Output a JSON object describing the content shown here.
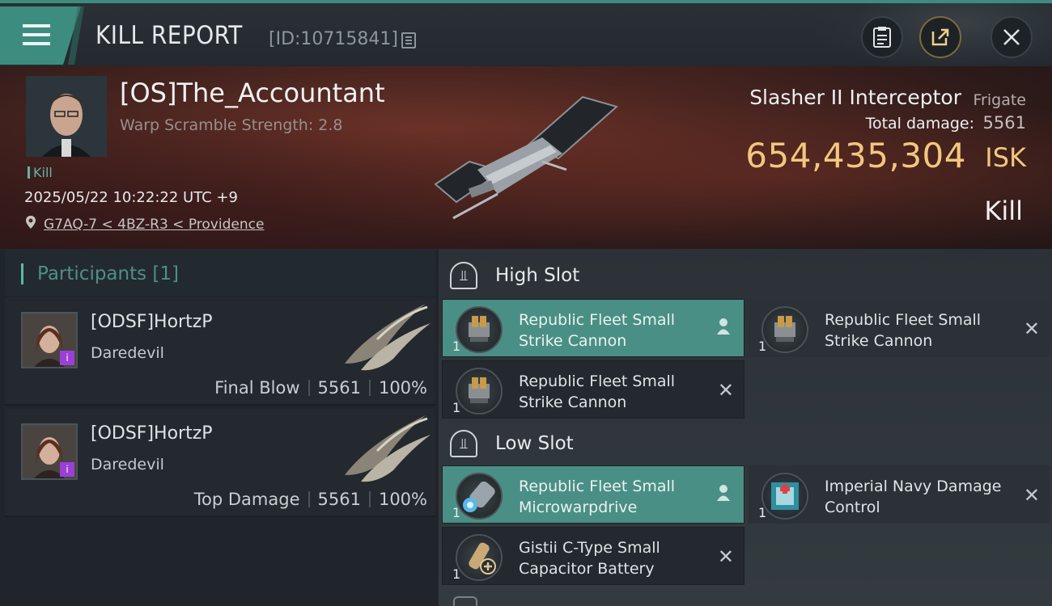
{
  "header": {
    "title": "KILL REPORT",
    "report_id": "[ID:10715841]"
  },
  "victim": {
    "name": "[OS]The_Accountant",
    "scramble": "Warp Scramble Strength: 2.8",
    "tag": "Kill",
    "datetime": "2025/05/22 10:22:22 UTC +9",
    "location": "G7AQ-7 < 4BZ-R3 < Providence",
    "ship_name": "Slasher II Interceptor",
    "ship_class": "Frigate",
    "total_damage_label": "Total damage:",
    "total_damage": "5561",
    "isk_value": "654,435,304",
    "isk_unit": "ISK",
    "kill_type": "Kill"
  },
  "participants": {
    "title": "Participants [1]",
    "items": [
      {
        "name": "[ODSF]HortzP",
        "ship": "Daredevil",
        "role": "Final Blow",
        "damage": "5561",
        "percent": "100%"
      },
      {
        "name": "[ODSF]HortzP",
        "ship": "Daredevil",
        "role": "Top Damage",
        "damage": "5561",
        "percent": "100%"
      }
    ]
  },
  "fitting": {
    "high_slot_label": "High Slot",
    "low_slot_label": "Low Slot",
    "high": [
      {
        "name": "Republic Fleet Small Strike Cannon",
        "qty": "1",
        "status": "user"
      },
      {
        "name": "Republic Fleet Small Strike Cannon",
        "qty": "1",
        "status": "destroyed"
      },
      {
        "name": "Republic Fleet Small Strike Cannon",
        "qty": "1",
        "status": "destroyed"
      }
    ],
    "low": [
      {
        "name": "Republic Fleet Small Microwarpdrive",
        "qty": "1",
        "status": "user"
      },
      {
        "name": "Imperial Navy Damage Control",
        "qty": "1",
        "status": "destroyed"
      },
      {
        "name": "Gistii C-Type Small Capacitor Battery",
        "qty": "1",
        "status": "destroyed"
      }
    ]
  },
  "colors": {
    "accent_teal": "#3d8c80",
    "isk_gold": "#f2c77e",
    "banner_red": "#6d3328"
  }
}
